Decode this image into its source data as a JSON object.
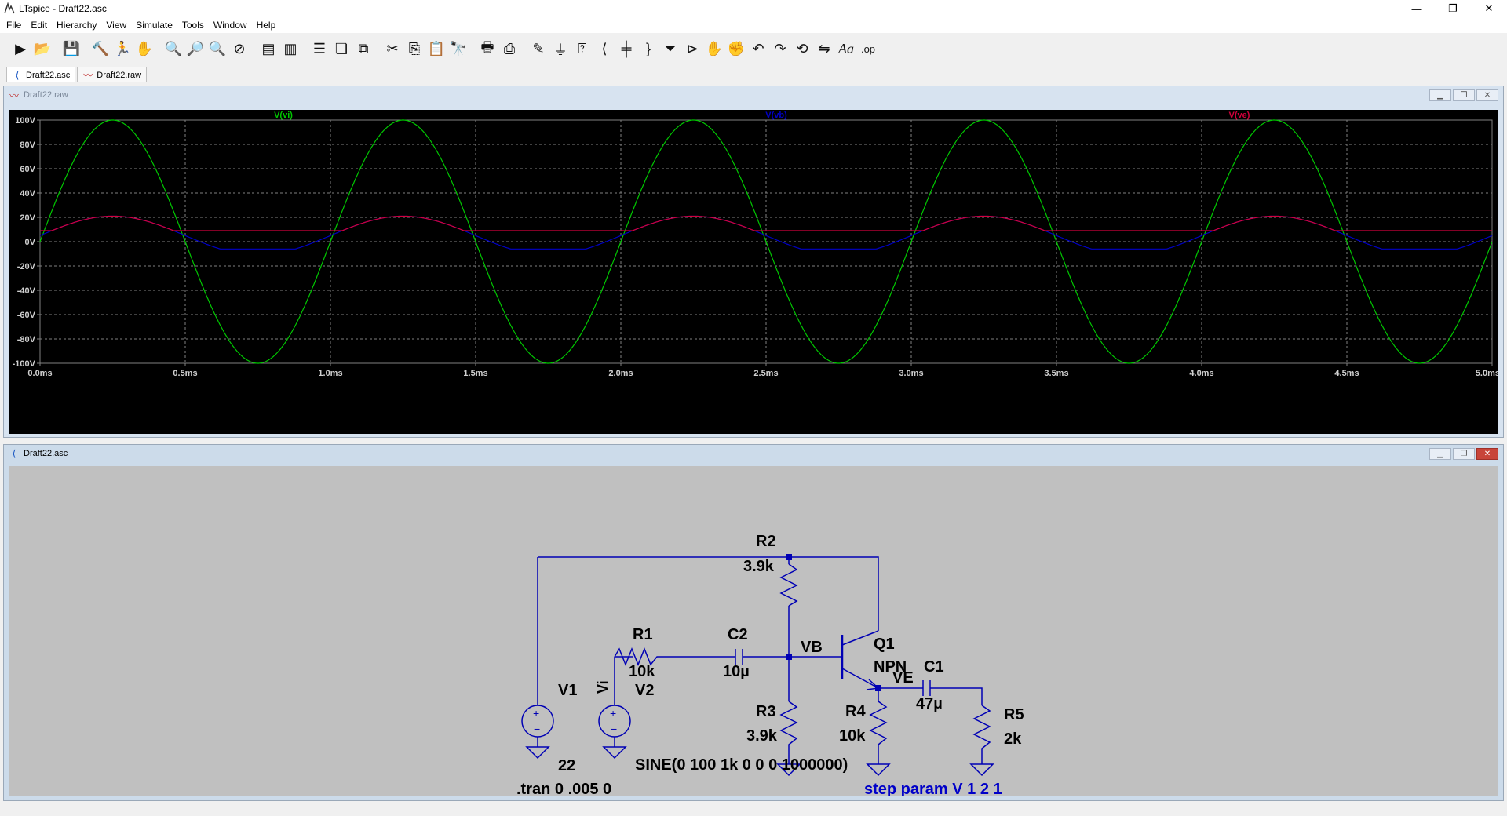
{
  "window": {
    "title": "LTspice - Draft22.asc",
    "controls": [
      "—",
      "❐",
      "✕"
    ]
  },
  "menu": [
    "File",
    "Edit",
    "Hierarchy",
    "View",
    "Simulate",
    "Tools",
    "Window",
    "Help"
  ],
  "toolbar_icons": [
    "run-icon",
    "open-icon",
    "save-icon",
    "control-panel-icon",
    "halt-icon",
    "pan-icon",
    "zoom-in-icon",
    "zoom-box-icon",
    "zoom-out-icon",
    "zoom-fit-icon",
    "autorange-icon",
    "measure-icon",
    "tile-horizontal-icon",
    "cascade-icon",
    "tile-vertical-icon",
    "cut-icon",
    "copy-icon",
    "paste-icon",
    "find-icon",
    "print-icon",
    "print-setup-icon",
    "wire-icon",
    "ground-icon",
    "label-net-icon",
    "resistor-icon",
    "capacitor-icon",
    "inductor-icon",
    "diode-icon",
    "component-icon",
    "move-icon",
    "drag-icon",
    "undo-icon",
    "redo-icon",
    "rotate-icon",
    "mirror-icon",
    "text-icon",
    "spice-directive-icon"
  ],
  "tabs": [
    {
      "label": "Draft22.asc",
      "icon": "schematic-icon"
    },
    {
      "label": "Draft22.raw",
      "icon": "waveform-icon"
    }
  ],
  "waveform_window": {
    "title": "Draft22.raw",
    "traces": [
      {
        "name": "V(vi)",
        "color": "#00c800"
      },
      {
        "name": "V(vb)",
        "color": "#0000c8"
      },
      {
        "name": "V(ve)",
        "color": "#d2003c"
      }
    ]
  },
  "schematic_window": {
    "title": "Draft22.asc",
    "labels": {
      "R2": "R2",
      "R2_val": "3.9k",
      "R1": "R1",
      "R1_val": "10k",
      "C2": "C2",
      "C2_val": "10µ",
      "VB": "VB",
      "Q1": "Q1",
      "Q1_val": "NPN",
      "C1": "C1",
      "C1_val": "47µ",
      "VE": "VE",
      "V1": "V1",
      "V1_val": "22",
      "V2": "V2",
      "V2_val": "SINE(0 100 1k 0 0 0 1000000)",
      "Vi": "Vi",
      "R3": "R3",
      "R3_val": "3.9k",
      "R4": "R4",
      "R4_val": "10k",
      "R5": "R5",
      "R5_val": "2k",
      "tran": ".tran 0 .005 0",
      "step": "step param V 1 2 1"
    },
    "wire_color": "#0000b4",
    "directive_color": "#0000c8"
  },
  "chart_data": {
    "type": "line",
    "x_unit": "ms",
    "xlim": [
      0,
      5
    ],
    "ylim": [
      -100,
      100
    ],
    "x_ticks": [
      "0.0ms",
      "0.5ms",
      "1.0ms",
      "1.5ms",
      "2.0ms",
      "2.5ms",
      "3.0ms",
      "3.5ms",
      "4.0ms",
      "4.5ms",
      "5.0ms"
    ],
    "y_ticks": [
      "100V",
      "80V",
      "60V",
      "40V",
      "20V",
      "0V",
      "-20V",
      "-40V",
      "-60V",
      "-80V",
      "-100V"
    ],
    "grid": true,
    "series": [
      {
        "name": "V(vi)",
        "function": "sine",
        "amplitude": 100,
        "frequency_khz": 1,
        "offset": 0
      },
      {
        "name": "V(vb)",
        "function": "clipped_sine",
        "amplitude": 16,
        "offset": 5,
        "min": -6,
        "max": 22
      },
      {
        "name": "V(ve)",
        "function": "clipped_sine",
        "amplitude": 16,
        "offset": 5,
        "min": 9,
        "max": 22
      }
    ]
  }
}
